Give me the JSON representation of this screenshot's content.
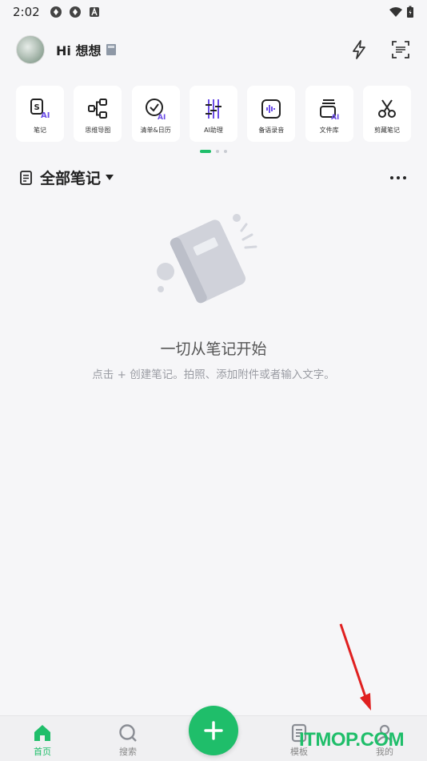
{
  "status_bar": {
    "time": "2:02",
    "icons": [
      "sync-icon",
      "sync-icon",
      "font-icon"
    ],
    "right_icons": [
      "wifi-icon",
      "battery-icon"
    ]
  },
  "header": {
    "greeting": "Hi 想想",
    "badge_icon": "member-badge-icon",
    "actions": [
      "flash-icon",
      "scan-icon"
    ]
  },
  "tools": [
    {
      "label": "笔记",
      "icon": "ai-note-icon"
    },
    {
      "label": "思维导图",
      "icon": "mindmap-icon"
    },
    {
      "label": "清单&日历",
      "icon": "checklist-calendar-icon"
    },
    {
      "label": "AI助理",
      "icon": "ai-assistant-icon"
    },
    {
      "label": "备语录音",
      "icon": "voice-record-icon"
    },
    {
      "label": "文件库",
      "icon": "file-library-icon"
    },
    {
      "label": "剪藏笔记",
      "icon": "clip-note-icon"
    }
  ],
  "section": {
    "title": "全部笔记"
  },
  "empty_state": {
    "title": "一切从笔记开始",
    "hint": "点击 + 创建笔记。拍照、添加附件或者输入文字。"
  },
  "bottom_nav": [
    {
      "label": "首页",
      "icon": "home-icon",
      "active": true
    },
    {
      "label": "搜索",
      "icon": "search-icon",
      "active": false
    },
    {
      "label": "模板",
      "icon": "template-icon",
      "active": false
    },
    {
      "label": "我的",
      "icon": "profile-icon",
      "active": false
    }
  ],
  "fab_icon": "plus-icon",
  "watermark": "ITMOP.COM",
  "colors": {
    "accent": "#1fbe6a",
    "ai_purple": "#6b4de6",
    "background": "#f6f6f8"
  }
}
